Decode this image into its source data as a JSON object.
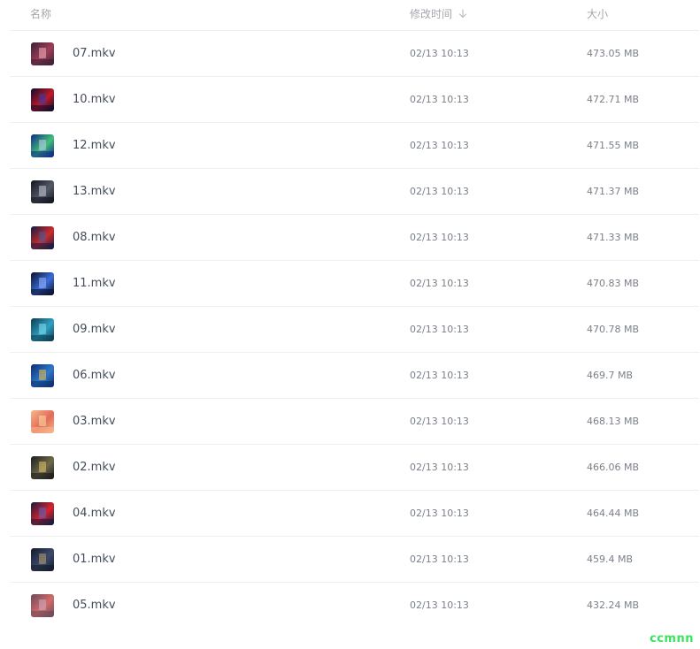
{
  "header": {
    "name_label": "名称",
    "modified_label": "修改时间",
    "size_label": "大小",
    "sort_icon": "arrow-down-icon"
  },
  "files": [
    {
      "name": "07.mkv",
      "modified": "02/13 10:13",
      "size": "473.05 MB",
      "thumb_colors": [
        "#3a2236",
        "#a23c58",
        "#f0b6c0"
      ]
    },
    {
      "name": "10.mkv",
      "modified": "02/13 10:13",
      "size": "472.71 MB",
      "thumb_colors": [
        "#0c0d2a",
        "#c2182b",
        "#2a3fb0"
      ]
    },
    {
      "name": "12.mkv",
      "modified": "02/13 10:13",
      "size": "471.55 MB",
      "thumb_colors": [
        "#0f2a88",
        "#43c07a",
        "#c6d0f0"
      ]
    },
    {
      "name": "13.mkv",
      "modified": "02/13 10:13",
      "size": "471.37 MB",
      "thumb_colors": [
        "#12141c",
        "#54596a",
        "#c9ccd6"
      ]
    },
    {
      "name": "08.mkv",
      "modified": "02/13 10:13",
      "size": "471.33 MB",
      "thumb_colors": [
        "#0f1c44",
        "#d12a2a",
        "#3b5fa8"
      ]
    },
    {
      "name": "11.mkv",
      "modified": "02/13 10:13",
      "size": "470.83 MB",
      "thumb_colors": [
        "#0a0f2a",
        "#3a6dd8",
        "#9fb8ff"
      ]
    },
    {
      "name": "09.mkv",
      "modified": "02/13 10:13",
      "size": "470.78 MB",
      "thumb_colors": [
        "#0e3a52",
        "#2fa1c2",
        "#86e0f0"
      ]
    },
    {
      "name": "06.mkv",
      "modified": "02/13 10:13",
      "size": "469.7 MB",
      "thumb_colors": [
        "#0b2e6e",
        "#2f79c9",
        "#f0c14a"
      ]
    },
    {
      "name": "03.mkv",
      "modified": "02/13 10:13",
      "size": "468.13 MB",
      "thumb_colors": [
        "#f7b889",
        "#e36a5a",
        "#fbe2a8"
      ]
    },
    {
      "name": "02.mkv",
      "modified": "02/13 10:13",
      "size": "466.06 MB",
      "thumb_colors": [
        "#1b1b1d",
        "#6f6a4a",
        "#e2c66a"
      ]
    },
    {
      "name": "04.mkv",
      "modified": "02/13 10:13",
      "size": "464.44 MB",
      "thumb_colors": [
        "#131a40",
        "#d8232c",
        "#4b6ad0"
      ]
    },
    {
      "name": "01.mkv",
      "modified": "02/13 10:13",
      "size": "459.4 MB",
      "thumb_colors": [
        "#141a2c",
        "#3c4a6a",
        "#b8a070"
      ]
    },
    {
      "name": "05.mkv",
      "modified": "02/13 10:13",
      "size": "432.24 MB",
      "thumb_colors": [
        "#6b4a5a",
        "#d46a6a",
        "#c8b0c8"
      ]
    }
  ],
  "watermark": {
    "text": "ccmnn",
    "color": "#39e35b"
  }
}
